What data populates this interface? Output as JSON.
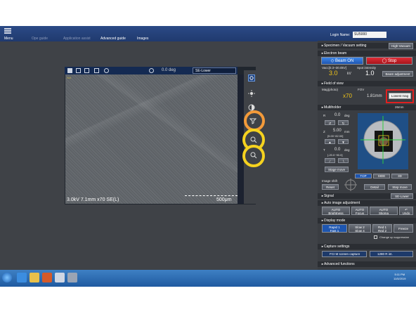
{
  "topbar": {
    "menu": "Menu",
    "op_guide": "Ope guide",
    "app_assist": "Application assist",
    "advanced_guide": "Advanced guide",
    "images": "Images",
    "login_label": "Login Name:",
    "login_value": "SU5000"
  },
  "image_panel": {
    "rotation": "0.0 deg",
    "rotation_unit": "deg",
    "detector": "SE-Lower",
    "mini_label": "Not",
    "caption": "3.0kV 7.1mm x70 SE(L)",
    "scale": "500μm"
  },
  "panel": {
    "specimen_header": "Specimen / Vacuum setting",
    "vacuum_btn": "High Vacuum",
    "electron_header": "Electron beam",
    "beam_on": "Beam ON",
    "stop": "Stop",
    "vacc_label": "Vacc[0.3~30.0kV]",
    "spot_label": "Spot intensity",
    "vacc_value": "3.0",
    "vacc_unit": "kV",
    "spot_value": "1.0",
    "beam_adjust": "Beam adjustment",
    "fov_header": "Field of view",
    "mag_label": "Mag(photo)",
    "fov_label": "FOV",
    "mag_value": "x70",
    "fov_value": "1.81mm",
    "lowest_mag": "Lowest mag",
    "multiholder_header": "Multiholder",
    "holder_size": "26mm",
    "r_label": "R",
    "r_value": "0.0",
    "r_unit": "deg",
    "z_label": "Z",
    "z_value": "5.00",
    "z_unit": "mm",
    "z_range": "[5.00~82.00]",
    "t_label": "T",
    "t_value": "0.0",
    "t_unit": "deg",
    "t_range": "[-20.0~90.0]",
    "stage_move": "Stage move",
    "view_top": "TOP",
    "view_side": "SIDE",
    "view_3d": "3D",
    "image_shift": "Image shift",
    "reset": "Reset",
    "detail": "Detail",
    "step_move": "Step move",
    "signal_header": "Signal",
    "signal_value": "SE-Lower",
    "auto_header": "Auto image adjustment",
    "auto_brightness": "Brightness",
    "auto_focus": "Focus",
    "auto_stigma": "Stigma",
    "undo": "Undo",
    "auto_prefix": "AUTO",
    "display_header": "Display mode",
    "rapid": "Rapid 1",
    "fast": "Fast 1",
    "slow": "Slow 2",
    "slow4": "Slow 4",
    "red1": "Red 1",
    "red2": "Red 2",
    "freeze": "Freeze",
    "change_sup": "Change up suppression",
    "capture_header": "Capture settings",
    "capture_mode": "FCI M screen capture",
    "capture_res": "1280 R int.",
    "advanced_header": "Advanced functions"
  },
  "taskbar": {
    "time": "5:11 PM",
    "date": "11/5/2019"
  },
  "colors": {
    "highlight_orange": "#f39a3a",
    "highlight_yellow": "#f5d21f",
    "highlight_red": "#e02020",
    "beam_on": "#2c6fd1",
    "stop": "#c8202a"
  }
}
